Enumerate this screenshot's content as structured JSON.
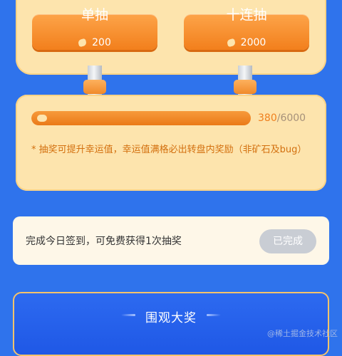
{
  "draw_buttons": {
    "single": {
      "label": "单抽",
      "cost": "200"
    },
    "ten": {
      "label": "十连抽",
      "cost": "2000"
    }
  },
  "luck": {
    "current": "380",
    "total": "/6000",
    "progress": 0.0633,
    "note": "* 抽奖可提升幸运值，幸运值满格必出转盘内奖励（非矿石及bug）"
  },
  "signin": {
    "text": "完成今日签到，可免费获得1次抽奖",
    "button": "已完成"
  },
  "watch": {
    "title": "围观大奖"
  },
  "watermark": "@稀土掘金技术社区",
  "colors": {
    "accent": "#f27f1c",
    "background": "#2f73ec",
    "panel": "#fde4ad"
  }
}
